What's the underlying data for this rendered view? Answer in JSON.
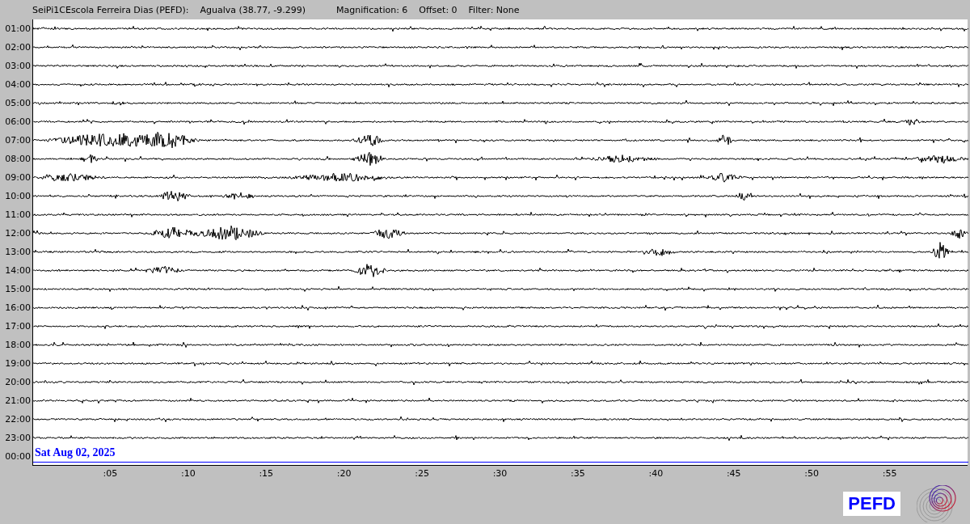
{
  "header": {
    "station": "SeiPi1CEscola Ferreira Dias (PEFD):",
    "location": "Agualva (38.77, -9.299)",
    "magnification": "Magnification: 6",
    "offset": "Offset: 0",
    "filter": "Filter: None"
  },
  "rows": [
    {
      "label": "01:00",
      "kind": "trace"
    },
    {
      "label": "02:00",
      "kind": "trace"
    },
    {
      "label": "03:00",
      "kind": "trace"
    },
    {
      "label": "04:00",
      "kind": "trace"
    },
    {
      "label": "05:00",
      "kind": "trace"
    },
    {
      "label": "06:00",
      "kind": "trace"
    },
    {
      "label": "07:00",
      "kind": "trace"
    },
    {
      "label": "08:00",
      "kind": "trace"
    },
    {
      "label": "09:00",
      "kind": "trace"
    },
    {
      "label": "10:00",
      "kind": "trace"
    },
    {
      "label": "11:00",
      "kind": "trace"
    },
    {
      "label": "12:00",
      "kind": "trace"
    },
    {
      "label": "13:00",
      "kind": "trace"
    },
    {
      "label": "14:00",
      "kind": "trace"
    },
    {
      "label": "15:00",
      "kind": "trace"
    },
    {
      "label": "16:00",
      "kind": "trace"
    },
    {
      "label": "17:00",
      "kind": "trace"
    },
    {
      "label": "18:00",
      "kind": "trace"
    },
    {
      "label": "19:00",
      "kind": "trace"
    },
    {
      "label": "20:00",
      "kind": "trace"
    },
    {
      "label": "21:00",
      "kind": "trace"
    },
    {
      "label": "22:00",
      "kind": "trace"
    },
    {
      "label": "23:00",
      "kind": "trace"
    },
    {
      "label": "00:00",
      "kind": "current"
    }
  ],
  "date": "Sat Aug 02, 2025",
  "x_ticks": [
    ":05",
    ":10",
    ":15",
    ":20",
    ":25",
    ":30",
    ":35",
    ":40",
    ":45",
    ":50",
    ":55"
  ],
  "station_code": "PEFD"
}
